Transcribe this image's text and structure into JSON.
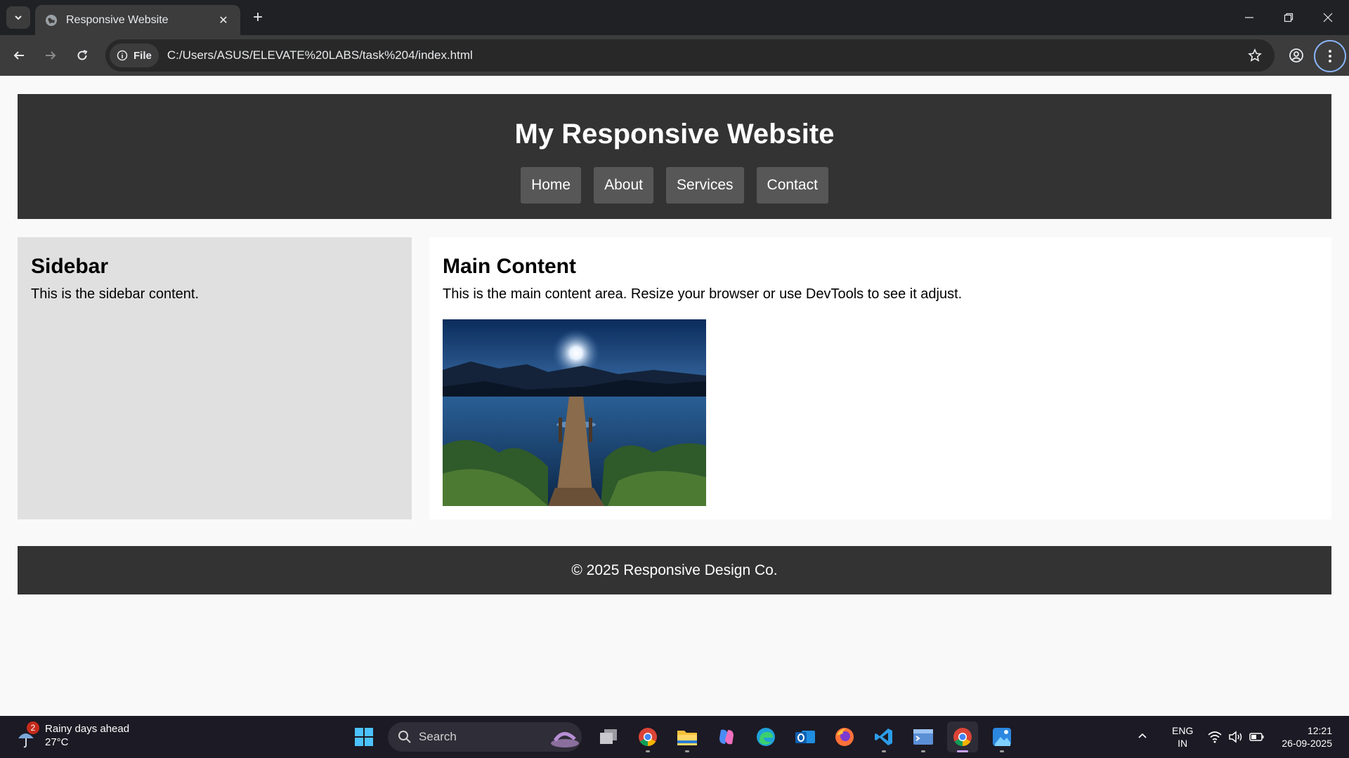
{
  "browser": {
    "tab_title": "Responsive Website",
    "address_chip": "File",
    "url": "C:/Users/ASUS/ELEVATE%20LABS/task%204/index.html"
  },
  "site": {
    "title": "My Responsive Website",
    "nav": [
      "Home",
      "About",
      "Services",
      "Contact"
    ],
    "sidebar": {
      "heading": "Sidebar",
      "text": "This is the sidebar content."
    },
    "main": {
      "heading": "Main Content",
      "text": "This is the main content area. Resize your browser or use DevTools to see it adjust."
    },
    "footer": "© 2025 Responsive Design Co."
  },
  "taskbar": {
    "weather_badge": "2",
    "weather_text": "Rainy days ahead",
    "temperature": "27°C",
    "search_placeholder": "Search",
    "apps": [
      "task-view",
      "chrome",
      "file-explorer",
      "copilot",
      "edge",
      "outlook",
      "firefox",
      "vscode",
      "terminal",
      "chrome-active",
      "photos"
    ],
    "lang_top": "ENG",
    "lang_bottom": "IN",
    "time": "12:21",
    "date": "26-09-2025"
  },
  "colors": {
    "header_bg": "#333333",
    "nav_button_bg": "#575757",
    "sidebar_bg": "#e0e0e0",
    "main_bg": "#ffffff",
    "page_bg": "#f9f9f9"
  }
}
